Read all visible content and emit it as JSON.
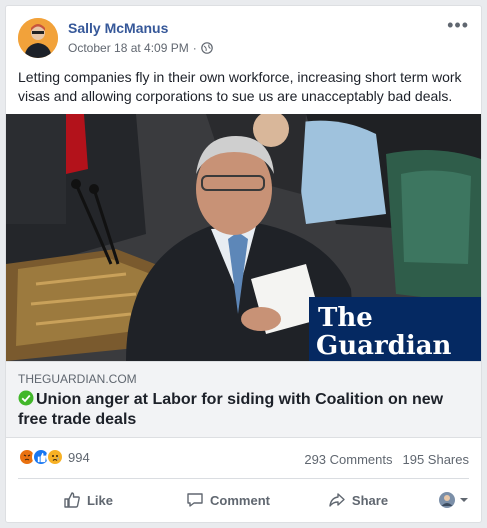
{
  "post": {
    "author": "Sally McManus",
    "timestamp": "October 18 at 4:09 PM",
    "dot": "·",
    "more_icon": "•••",
    "text": "Letting companies fly in their own workforce, increasing short term work visas and allowing corporations to sue us are unacceptably bad deals."
  },
  "link": {
    "domain": "THEGUARDIAN.COM",
    "headline": "Union anger at Labor for siding with Coalition on new free trade deals",
    "publisher_logo_line1": "The",
    "publisher_logo_line2": "Guardian"
  },
  "stats": {
    "reactions_count": "994",
    "comments": "293 Comments",
    "shares": "195 Shares"
  },
  "actions": {
    "like": "Like",
    "comment": "Comment",
    "share": "Share"
  },
  "colors": {
    "brand_blue": "#365899",
    "guardian_navy": "#052962",
    "angry": "#e9710f",
    "like": "#1877f2",
    "sad": "#f7b125"
  }
}
